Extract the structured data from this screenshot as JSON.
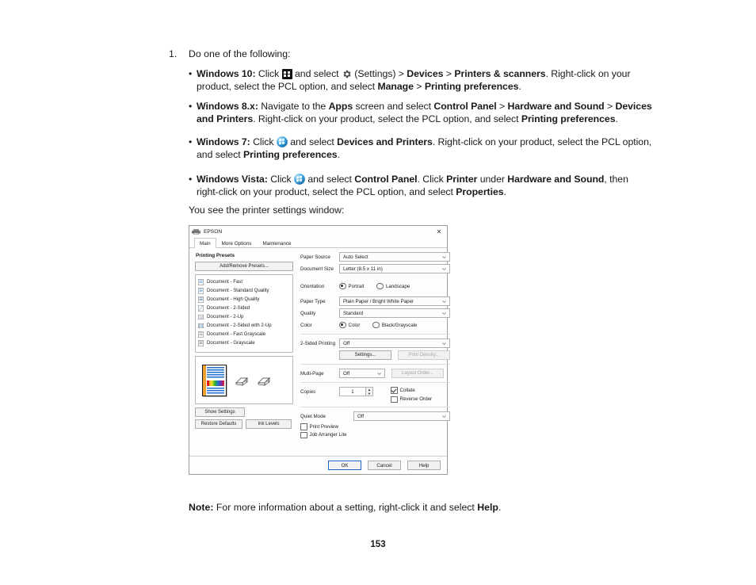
{
  "page": {
    "step_number": "1.",
    "step_text": "Do one of the following:",
    "you_see": "You see the printer settings window:",
    "page_number": "153"
  },
  "bullets": [
    {
      "label": "Windows 10:",
      "icons": [
        "windows-logo-icon",
        "settings-gear-icon"
      ],
      "t1": " Click ",
      "t2": " and select ",
      "t3": " (Settings) > ",
      "b1": "Devices",
      "t4": " > ",
      "b2": "Printers & scanners",
      "t5": ". Right-click on your product, select the PCL option, and select ",
      "b3": "Manage",
      "t6": " > ",
      "b4": "Printing preferences",
      "t7": "."
    },
    {
      "label": "Windows 8.x:",
      "t1": " Navigate to the ",
      "b1": "Apps",
      "t2": " screen and select ",
      "b2": "Control Panel",
      "t3": " > ",
      "b3": "Hardware and Sound",
      "t4": " > ",
      "b4": "Devices and Printers",
      "t5": ". Right-click on your product, select the PCL option, and select ",
      "b5": "Printing preferences",
      "t6": "."
    },
    {
      "label": "Windows 7:",
      "icons": [
        "windows-orb-icon"
      ],
      "t1": " Click ",
      "t2": " and select ",
      "b1": "Devices and Printers",
      "t3": ". Right-click on your product, select the PCL option, and select ",
      "b2": "Printing preferences",
      "t4": "."
    },
    {
      "label": "Windows Vista:",
      "icons": [
        "windows-orb-icon"
      ],
      "t1": " Click ",
      "t2": " and select ",
      "b1": "Control Panel",
      "t3": ". Click ",
      "b2": "Printer",
      "t4": " under ",
      "b3": "Hardware and Sound",
      "t5": ", then right-click on your product, select the PCL option, and select ",
      "b4": "Properties",
      "t6": "."
    }
  ],
  "note": {
    "label": "Note:",
    "text": " For more information about a setting, right-click it and select ",
    "bold": "Help",
    "tail": "."
  },
  "dialog": {
    "title": "EPSON",
    "close_label": "✕",
    "tabs": [
      {
        "label": "Main",
        "active": true
      },
      {
        "label": "More Options",
        "active": false
      },
      {
        "label": "Maintenance",
        "active": false
      }
    ],
    "presets_title": "Printing Presets",
    "add_remove_presets": "Add/Remove Presets...",
    "presets": [
      "Document - Fast",
      "Document - Standard Quality",
      "Document - High Quality",
      "Document - 2-Sided",
      "Document - 2-Up",
      "Document - 2-Sided with 2-Up",
      "Document - Fast Grayscale",
      "Document - Grayscale"
    ],
    "show_settings": "Show Settings",
    "restore_defaults": "Restore Defaults",
    "ink_levels": "Ink Levels",
    "fields": {
      "paper_source_label": "Paper Source",
      "paper_source_value": "Auto Select",
      "document_size_label": "Document Size",
      "document_size_value": "Letter (8.5 x 11 in)",
      "orientation_label": "Orientation",
      "orientation_portrait": "Portrait",
      "orientation_landscape": "Landscape",
      "orientation_selected": "Portrait",
      "paper_type_label": "Paper Type",
      "paper_type_value": "Plain Paper / Bright White Paper",
      "quality_label": "Quality",
      "quality_value": "Standard",
      "color_label": "Color",
      "color_color": "Color",
      "color_bw": "Black/Grayscale",
      "color_selected": "Color",
      "two_sided_label": "2-Sided Printing",
      "two_sided_value": "Off",
      "settings_button": "Settings...",
      "print_density_button": "Print Density...",
      "multi_page_label": "Multi-Page",
      "multi_page_value": "Off",
      "layout_order_button": "Layout Order...",
      "copies_label": "Copies",
      "copies_value": "1",
      "collate_label": "Collate",
      "collate_checked": true,
      "reverse_order_label": "Reverse Order",
      "reverse_order_checked": false,
      "quiet_mode_label": "Quiet Mode",
      "quiet_mode_value": "Off",
      "print_preview_label": "Print Preview",
      "print_preview_checked": false,
      "job_arranger_label": "Job Arranger Lite",
      "job_arranger_checked": false
    },
    "footer": {
      "ok": "OK",
      "cancel": "Cancel",
      "help": "Help"
    }
  }
}
